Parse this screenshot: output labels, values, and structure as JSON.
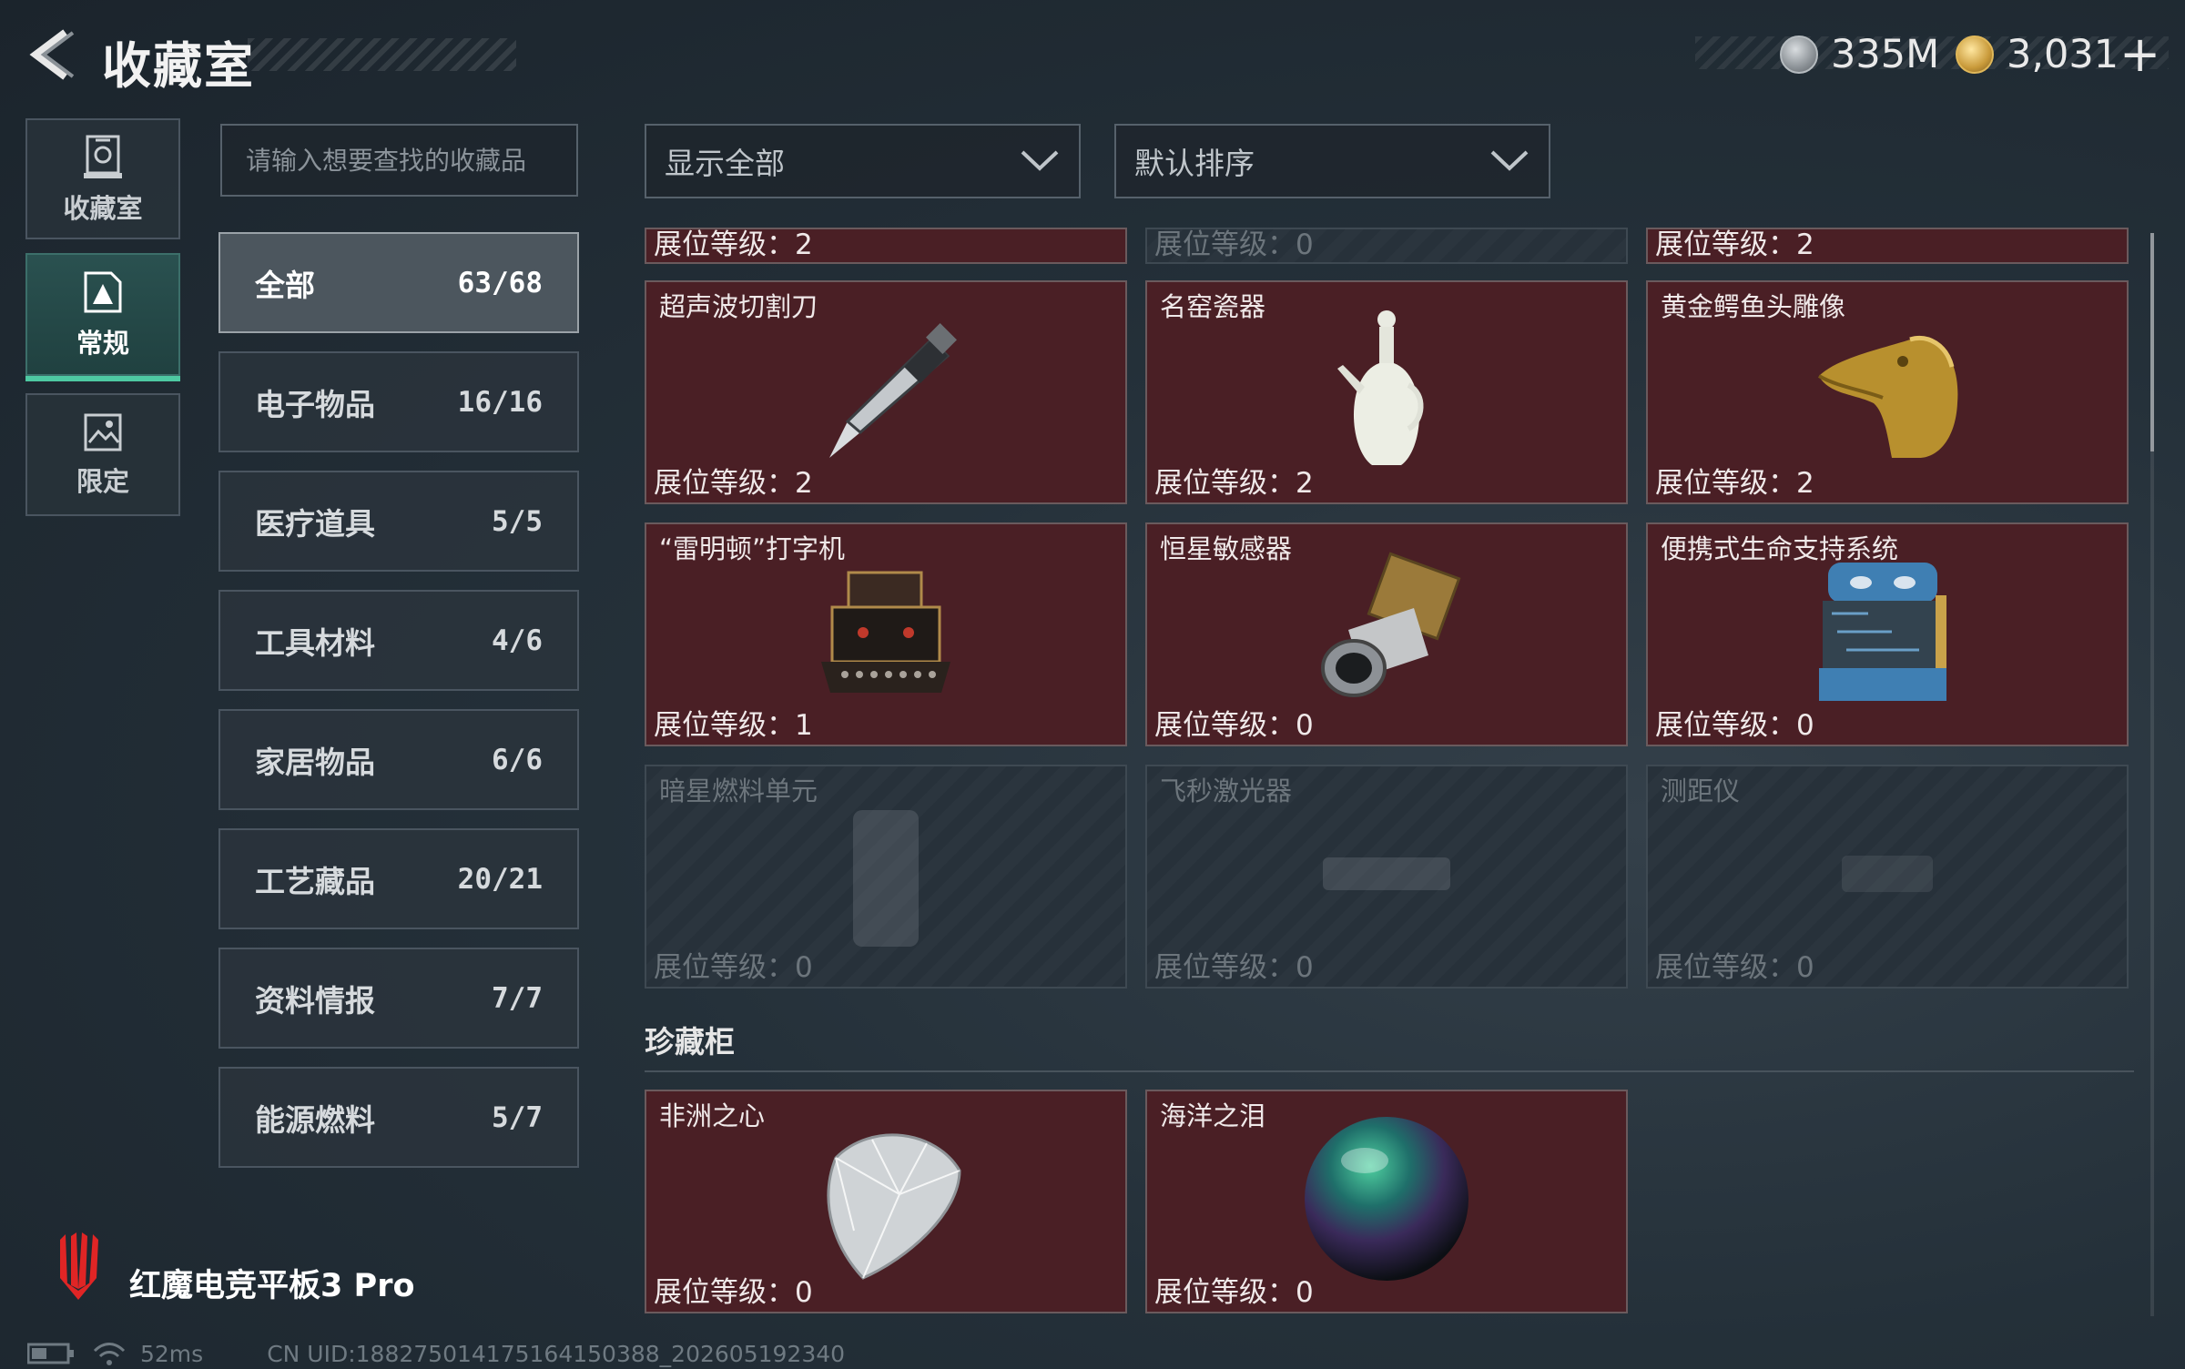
{
  "header": {
    "title": "收藏室",
    "currencies": [
      {
        "icon": "silver-coin-icon",
        "value": "335M"
      },
      {
        "icon": "gold-coin-icon",
        "value": "3,031"
      }
    ],
    "add_label": "+"
  },
  "nav": [
    {
      "label": "收藏室",
      "icon": "trophy-icon"
    },
    {
      "label": "常规",
      "icon": "picture-frame-icon",
      "selected": true
    },
    {
      "label": "限定",
      "icon": "landscape-frame-icon"
    }
  ],
  "search": {
    "placeholder": "请输入想要查找的收藏品",
    "value": ""
  },
  "categories": [
    {
      "name": "全部",
      "count": "63/68",
      "selected": true
    },
    {
      "name": "电子物品",
      "count": "16/16"
    },
    {
      "name": "医疗道具",
      "count": "5/5"
    },
    {
      "name": "工具材料",
      "count": "4/6"
    },
    {
      "name": "家居物品",
      "count": "6/6"
    },
    {
      "name": "工艺藏品",
      "count": "20/21"
    },
    {
      "name": "资料情报",
      "count": "7/7"
    },
    {
      "name": "能源燃料",
      "count": "5/7"
    }
  ],
  "filters": {
    "display": "显示全部",
    "sort": "默认排序"
  },
  "partial_row": [
    {
      "level": "展位等级：2",
      "locked": false
    },
    {
      "level": "展位等级：0",
      "locked": true
    },
    {
      "level": "展位等级：2",
      "locked": false
    }
  ],
  "items": [
    {
      "name": "超声波切割刀",
      "level": "展位等级：2",
      "icon": "ultrasonic-knife-icon",
      "locked": false
    },
    {
      "name": "名窑瓷器",
      "level": "展位等级：2",
      "icon": "porcelain-vase-icon",
      "locked": false
    },
    {
      "name": "黄金鳄鱼头雕像",
      "level": "展位等级：2",
      "icon": "golden-crocodile-statue-icon",
      "locked": false
    },
    {
      "name": "“雷明顿”打字机",
      "level": "展位等级：1",
      "icon": "typewriter-icon",
      "locked": false
    },
    {
      "name": "恒星敏感器",
      "level": "展位等级：0",
      "icon": "star-sensor-icon",
      "locked": false
    },
    {
      "name": "便携式生命支持系统",
      "level": "展位等级：0",
      "icon": "life-support-icon",
      "locked": false
    },
    {
      "name": "暗星燃料单元",
      "level": "展位等级：0",
      "icon": "fuel-cell-icon",
      "locked": true
    },
    {
      "name": "飞秒激光器",
      "level": "展位等级：0",
      "icon": "laser-icon",
      "locked": true
    },
    {
      "name": "测距仪",
      "level": "展位等级：0",
      "icon": "rangefinder-icon",
      "locked": true
    }
  ],
  "treasure": {
    "title": "珍藏柜",
    "items": [
      {
        "name": "非洲之心",
        "level": "展位等级：0",
        "icon": "diamond-icon"
      },
      {
        "name": "海洋之泪",
        "level": "展位等级：0",
        "icon": "pearl-icon"
      }
    ]
  },
  "footer": {
    "brand": "红魔电竞平板3 Pro",
    "ping": "52ms",
    "uid": "CN UID:188275014175164150388_202605192340"
  }
}
